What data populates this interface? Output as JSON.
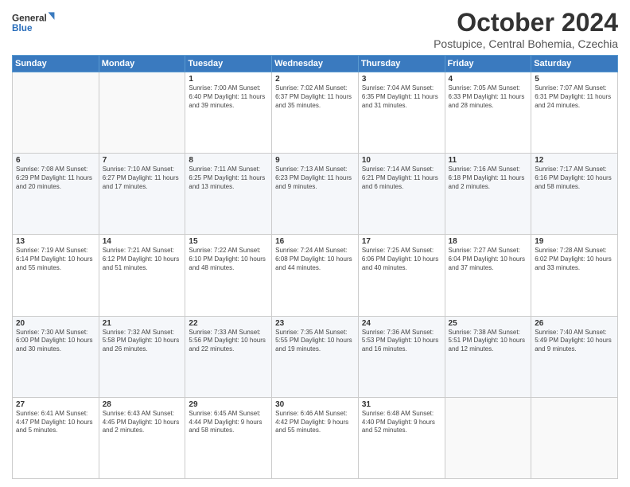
{
  "logo": {
    "line1": "General",
    "line2": "Blue"
  },
  "title": "October 2024",
  "location": "Postupice, Central Bohemia, Czechia",
  "days_header": [
    "Sunday",
    "Monday",
    "Tuesday",
    "Wednesday",
    "Thursday",
    "Friday",
    "Saturday"
  ],
  "weeks": [
    [
      {
        "day": "",
        "content": ""
      },
      {
        "day": "",
        "content": ""
      },
      {
        "day": "1",
        "content": "Sunrise: 7:00 AM\nSunset: 6:40 PM\nDaylight: 11 hours and 39 minutes."
      },
      {
        "day": "2",
        "content": "Sunrise: 7:02 AM\nSunset: 6:37 PM\nDaylight: 11 hours and 35 minutes."
      },
      {
        "day": "3",
        "content": "Sunrise: 7:04 AM\nSunset: 6:35 PM\nDaylight: 11 hours and 31 minutes."
      },
      {
        "day": "4",
        "content": "Sunrise: 7:05 AM\nSunset: 6:33 PM\nDaylight: 11 hours and 28 minutes."
      },
      {
        "day": "5",
        "content": "Sunrise: 7:07 AM\nSunset: 6:31 PM\nDaylight: 11 hours and 24 minutes."
      }
    ],
    [
      {
        "day": "6",
        "content": "Sunrise: 7:08 AM\nSunset: 6:29 PM\nDaylight: 11 hours and 20 minutes."
      },
      {
        "day": "7",
        "content": "Sunrise: 7:10 AM\nSunset: 6:27 PM\nDaylight: 11 hours and 17 minutes."
      },
      {
        "day": "8",
        "content": "Sunrise: 7:11 AM\nSunset: 6:25 PM\nDaylight: 11 hours and 13 minutes."
      },
      {
        "day": "9",
        "content": "Sunrise: 7:13 AM\nSunset: 6:23 PM\nDaylight: 11 hours and 9 minutes."
      },
      {
        "day": "10",
        "content": "Sunrise: 7:14 AM\nSunset: 6:21 PM\nDaylight: 11 hours and 6 minutes."
      },
      {
        "day": "11",
        "content": "Sunrise: 7:16 AM\nSunset: 6:18 PM\nDaylight: 11 hours and 2 minutes."
      },
      {
        "day": "12",
        "content": "Sunrise: 7:17 AM\nSunset: 6:16 PM\nDaylight: 10 hours and 58 minutes."
      }
    ],
    [
      {
        "day": "13",
        "content": "Sunrise: 7:19 AM\nSunset: 6:14 PM\nDaylight: 10 hours and 55 minutes."
      },
      {
        "day": "14",
        "content": "Sunrise: 7:21 AM\nSunset: 6:12 PM\nDaylight: 10 hours and 51 minutes."
      },
      {
        "day": "15",
        "content": "Sunrise: 7:22 AM\nSunset: 6:10 PM\nDaylight: 10 hours and 48 minutes."
      },
      {
        "day": "16",
        "content": "Sunrise: 7:24 AM\nSunset: 6:08 PM\nDaylight: 10 hours and 44 minutes."
      },
      {
        "day": "17",
        "content": "Sunrise: 7:25 AM\nSunset: 6:06 PM\nDaylight: 10 hours and 40 minutes."
      },
      {
        "day": "18",
        "content": "Sunrise: 7:27 AM\nSunset: 6:04 PM\nDaylight: 10 hours and 37 minutes."
      },
      {
        "day": "19",
        "content": "Sunrise: 7:28 AM\nSunset: 6:02 PM\nDaylight: 10 hours and 33 minutes."
      }
    ],
    [
      {
        "day": "20",
        "content": "Sunrise: 7:30 AM\nSunset: 6:00 PM\nDaylight: 10 hours and 30 minutes."
      },
      {
        "day": "21",
        "content": "Sunrise: 7:32 AM\nSunset: 5:58 PM\nDaylight: 10 hours and 26 minutes."
      },
      {
        "day": "22",
        "content": "Sunrise: 7:33 AM\nSunset: 5:56 PM\nDaylight: 10 hours and 22 minutes."
      },
      {
        "day": "23",
        "content": "Sunrise: 7:35 AM\nSunset: 5:55 PM\nDaylight: 10 hours and 19 minutes."
      },
      {
        "day": "24",
        "content": "Sunrise: 7:36 AM\nSunset: 5:53 PM\nDaylight: 10 hours and 16 minutes."
      },
      {
        "day": "25",
        "content": "Sunrise: 7:38 AM\nSunset: 5:51 PM\nDaylight: 10 hours and 12 minutes."
      },
      {
        "day": "26",
        "content": "Sunrise: 7:40 AM\nSunset: 5:49 PM\nDaylight: 10 hours and 9 minutes."
      }
    ],
    [
      {
        "day": "27",
        "content": "Sunrise: 6:41 AM\nSunset: 4:47 PM\nDaylight: 10 hours and 5 minutes."
      },
      {
        "day": "28",
        "content": "Sunrise: 6:43 AM\nSunset: 4:45 PM\nDaylight: 10 hours and 2 minutes."
      },
      {
        "day": "29",
        "content": "Sunrise: 6:45 AM\nSunset: 4:44 PM\nDaylight: 9 hours and 58 minutes."
      },
      {
        "day": "30",
        "content": "Sunrise: 6:46 AM\nSunset: 4:42 PM\nDaylight: 9 hours and 55 minutes."
      },
      {
        "day": "31",
        "content": "Sunrise: 6:48 AM\nSunset: 4:40 PM\nDaylight: 9 hours and 52 minutes."
      },
      {
        "day": "",
        "content": ""
      },
      {
        "day": "",
        "content": ""
      }
    ]
  ]
}
